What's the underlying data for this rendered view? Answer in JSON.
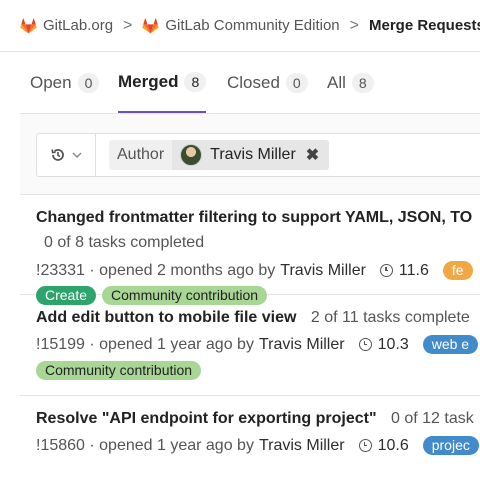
{
  "breadcrumb": {
    "items": [
      "GitLab.org",
      "GitLab Community Edition"
    ],
    "current": "Merge Requests",
    "separator": ">"
  },
  "tabs": [
    {
      "label": "Open",
      "count": "0",
      "active": false
    },
    {
      "label": "Merged",
      "count": "8",
      "active": true
    },
    {
      "label": "Closed",
      "count": "0",
      "active": false
    },
    {
      "label": "All",
      "count": "8",
      "active": false
    }
  ],
  "filter": {
    "history_icon": "history-icon",
    "token_name": "Author",
    "token_value": "Travis Miller",
    "remove_symbol": "✖"
  },
  "merge_requests": [
    {
      "title": "Changed frontmatter filtering to support YAML, JSON, TO",
      "tasks": "0 of 8 tasks completed",
      "meta": "!23331 · opened 2 months ago by",
      "author": "Travis Miller",
      "milestone": "11.6",
      "tag": "fe",
      "labels": [
        "Create",
        "Community contribution"
      ]
    },
    {
      "title": "Add edit button to mobile file view",
      "tasks": "2 of 11 tasks complete",
      "meta": "!15199 · opened 1 year ago by",
      "author": "Travis Miller",
      "milestone": "10.3",
      "tag": "web e",
      "labels": [
        "Community contribution"
      ]
    },
    {
      "title": "Resolve \"API endpoint for exporting project\"",
      "tasks": "0 of 12 task",
      "meta": "!15860 · opened 1 year ago by",
      "author": "Travis Miller",
      "milestone": "10.6",
      "tag": "projec",
      "labels": []
    }
  ],
  "colors": {
    "accent": "#6b4fbb",
    "create_label": "#2ea36b",
    "community_label": "#a8d695",
    "frontend_label": "#f0a844",
    "blue_label": "#428bca"
  }
}
